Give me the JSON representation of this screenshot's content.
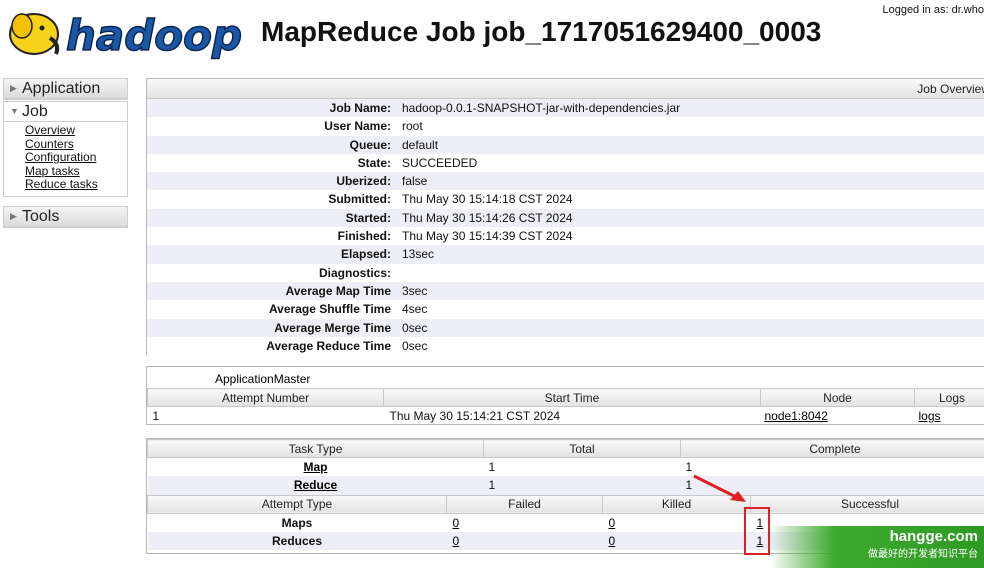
{
  "header": {
    "logo_text": "hadoop",
    "title": "MapReduce Job job_1717051629400_0003",
    "logged_in": "Logged in as: dr.who"
  },
  "sidebar": {
    "application": "Application",
    "job": "Job",
    "job_links": [
      "Overview",
      "Counters",
      "Configuration",
      "Map tasks",
      "Reduce tasks"
    ],
    "tools": "Tools"
  },
  "overview": {
    "caption": "Job Overview",
    "rows": [
      {
        "key": "Job Name:",
        "value": "hadoop-0.0.1-SNAPSHOT-jar-with-dependencies.jar"
      },
      {
        "key": "User Name:",
        "value": "root"
      },
      {
        "key": "Queue:",
        "value": "default"
      },
      {
        "key": "State:",
        "value": "SUCCEEDED"
      },
      {
        "key": "Uberized:",
        "value": "false"
      },
      {
        "key": "Submitted:",
        "value": "Thu May 30 15:14:18 CST 2024"
      },
      {
        "key": "Started:",
        "value": "Thu May 30 15:14:26 CST 2024"
      },
      {
        "key": "Finished:",
        "value": "Thu May 30 15:14:39 CST 2024"
      },
      {
        "key": "Elapsed:",
        "value": "13sec"
      },
      {
        "key": "Diagnostics:",
        "value": ""
      },
      {
        "key": "Average Map Time",
        "value": "3sec"
      },
      {
        "key": "Average Shuffle Time",
        "value": "4sec"
      },
      {
        "key": "Average Merge Time",
        "value": "0sec"
      },
      {
        "key": "Average Reduce Time",
        "value": "0sec"
      }
    ]
  },
  "app_master": {
    "title": "ApplicationMaster",
    "headers": [
      "Attempt Number",
      "Start Time",
      "Node",
      "Logs"
    ],
    "row": {
      "attempt": "1",
      "start_time": "Thu May 30 15:14:21 CST 2024",
      "node": "node1:8042",
      "logs": "logs"
    }
  },
  "tasks": {
    "headers": [
      "Task Type",
      "Total",
      "Complete"
    ],
    "rows": [
      {
        "type": "Map",
        "total": "1",
        "complete": "1"
      },
      {
        "type": "Reduce",
        "total": "1",
        "complete": "1"
      }
    ],
    "attempt_headers": [
      "Attempt Type",
      "Failed",
      "Killed",
      "Successful"
    ],
    "attempt_rows": [
      {
        "type": "Maps",
        "failed": "0",
        "killed": "0",
        "successful": "1"
      },
      {
        "type": "Reduces",
        "failed": "0",
        "killed": "0",
        "successful": "1"
      }
    ]
  },
  "watermark": {
    "main": "hangge.com",
    "sub": "做最好的开发者知识平台"
  },
  "colors": {
    "highlight": "#e02020",
    "stripe": "#eeeef8",
    "watermark": "#3ea92e"
  }
}
